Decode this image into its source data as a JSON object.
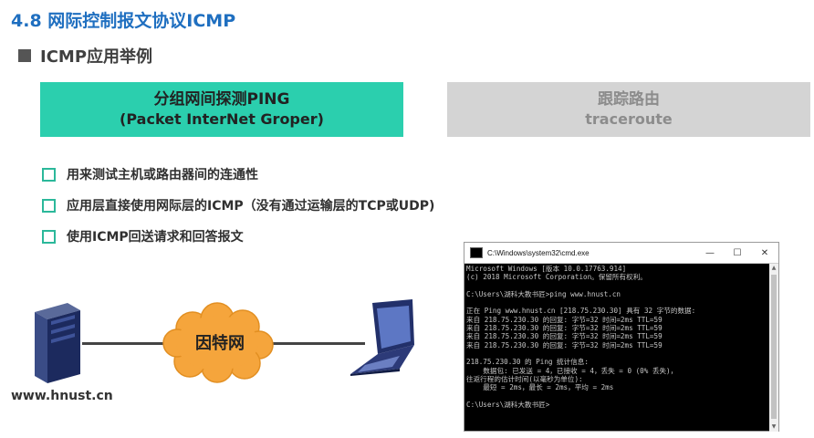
{
  "slide": {
    "title": "4.8 网际控制报文协议ICMP",
    "subtitle": "ICMP应用举例"
  },
  "tabs": [
    {
      "line1": "分组网间探测PING",
      "line2": "(Packet InterNet Groper)",
      "active": true
    },
    {
      "line1": "跟踪路由",
      "line2": "traceroute",
      "active": false
    }
  ],
  "bullets": [
    "用来测试主机或路由器间的连通性",
    "应用层直接使用网际层的ICMP（没有通过运输层的TCP或UDP)",
    "使用ICMP回送请求和回答报文"
  ],
  "diagram": {
    "cloud_label": "因特网",
    "host_label": "www.hnust.cn"
  },
  "cmd": {
    "title": "C:\\Windows\\system32\\cmd.exe",
    "minimize": "—",
    "maximize": "☐",
    "close": "✕",
    "lines": [
      "Microsoft Windows [版本 10.0.17763.914]",
      "(c) 2018 Microsoft Corporation。保留所有权利。",
      "",
      "C:\\Users\\湖科大教书匠>ping www.hnust.cn",
      "",
      "正在 Ping www.hnust.cn [218.75.230.30] 具有 32 字节的数据:",
      "来自 218.75.230.30 的回复: 字节=32 时间=2ms TTL=59",
      "来自 218.75.230.30 的回复: 字节=32 时间=2ms TTL=59",
      "来自 218.75.230.30 的回复: 字节=32 时间=2ms TTL=59",
      "来自 218.75.230.30 的回复: 字节=32 时间=2ms TTL=59",
      "",
      "218.75.230.30 的 Ping 统计信息:",
      "    数据包: 已发送 = 4，已接收 = 4，丢失 = 0 (0% 丢失)，",
      "往返行程的估计时间(以毫秒为单位):",
      "    最短 = 2ms，最长 = 2ms，平均 = 2ms",
      "",
      "C:\\Users\\湖科大教书匠>"
    ]
  },
  "colors": {
    "title_blue": "#1f6fc0",
    "tab_active": "#2bcfae",
    "tab_inactive": "#d4d4d4",
    "cloud": "#f5a53c"
  }
}
